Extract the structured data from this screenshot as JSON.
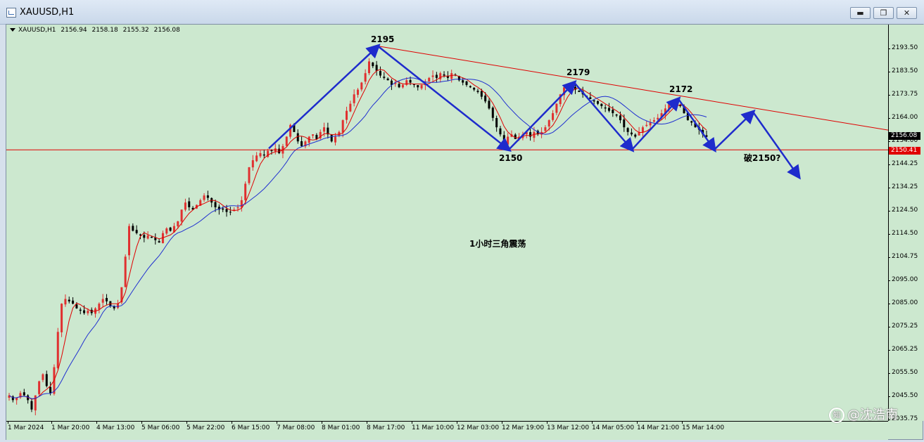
{
  "window": {
    "title": "XAUUSD,H1",
    "buttons": [
      "minimize",
      "restore",
      "close"
    ]
  },
  "header": {
    "symbol": "XAUUSD,H1",
    "open": "2156.94",
    "high": "2158.18",
    "low": "2155.32",
    "close": "2156.08"
  },
  "price_axis": {
    "ticks": [
      "2193.50",
      "2183.50",
      "2173.75",
      "2164.00",
      "2154.00",
      "2144.25",
      "2134.25",
      "2124.50",
      "2114.50",
      "2104.75",
      "2095.00",
      "2085.00",
      "2075.25",
      "2065.25",
      "2055.50",
      "2045.50",
      "2035.75"
    ],
    "current_price": "2156.08",
    "line_price": "2150.41",
    "current_color": "#000000",
    "line_color": "#e00000"
  },
  "time_axis": {
    "ticks": [
      "1 Mar 2024",
      "1 Mar 20:00",
      "4 Mar 13:00",
      "5 Mar 06:00",
      "5 Mar 22:00",
      "6 Mar 15:00",
      "7 Mar 08:00",
      "8 Mar 01:00",
      "8 Mar 17:00",
      "11 Mar 10:00",
      "12 Mar 03:00",
      "12 Mar 19:00",
      "13 Mar 12:00",
      "14 Mar 05:00",
      "14 Mar 21:00",
      "15 Mar 14:00"
    ]
  },
  "annotations": {
    "peak1": "2195",
    "peak2": "2179",
    "peak3": "2172",
    "low1": "2150",
    "break_label": "破2150?",
    "pattern_label": "1小时三角震荡"
  },
  "watermark": "@沈浩南",
  "colors": {
    "background": "#cce8cf",
    "bull_candle": "#e03030",
    "bear_candle": "#000000",
    "ma_fast": "#e00000",
    "ma_slow": "#2030d0",
    "arrow": "#1e2bcc",
    "trendline": "#e00000"
  },
  "chart_data": {
    "type": "candlestick",
    "symbol": "XAUUSD",
    "timeframe": "H1",
    "ylim": [
      2035.75,
      2198
    ],
    "support_level": 2150.41,
    "descending_trendline": [
      [
        2195,
        "8 Mar 17:00"
      ],
      [
        2172,
        "15 Mar 05:00"
      ]
    ],
    "swing_points": [
      {
        "label": "2195",
        "value": 2195,
        "type": "high"
      },
      {
        "label": "2150",
        "value": 2150,
        "type": "low"
      },
      {
        "label": "2179",
        "value": 2179,
        "type": "high"
      },
      {
        "label": "2172",
        "value": 2172,
        "type": "high"
      }
    ],
    "closes": [
      2046,
      2044,
      2045,
      2047,
      2046,
      2044,
      2040,
      2046,
      2052,
      2055,
      2050,
      2047,
      2058,
      2073,
      2085,
      2087,
      2086,
      2085,
      2083,
      2082,
      2081,
      2082,
      2081,
      2083,
      2085,
      2087,
      2086,
      2084,
      2083,
      2085,
      2092,
      2105,
      2118,
      2116,
      2115,
      2114,
      2113,
      2114,
      2113,
      2112,
      2111,
      2115,
      2117,
      2116,
      2118,
      2120,
      2125,
      2128,
      2126,
      2125,
      2127,
      2129,
      2131,
      2130,
      2128,
      2126,
      2125,
      2125,
      2124,
      2124,
      2125,
      2126,
      2129,
      2136,
      2143,
      2146,
      2148,
      2149,
      2148,
      2150,
      2150,
      2151,
      2149,
      2152,
      2156,
      2161,
      2158,
      2154,
      2152,
      2154,
      2156,
      2157,
      2155,
      2158,
      2160,
      2157,
      2154,
      2156,
      2158,
      2163,
      2167,
      2170,
      2174,
      2176,
      2179,
      2183,
      2188,
      2186,
      2184,
      2182,
      2181,
      2180,
      2178,
      2179,
      2177,
      2178,
      2180,
      2179,
      2178,
      2177,
      2178,
      2179,
      2181,
      2182,
      2181,
      2183,
      2182,
      2181,
      2183,
      2182,
      2180,
      2179,
      2178,
      2177,
      2176,
      2175,
      2173,
      2171,
      2168,
      2164,
      2160,
      2157,
      2153,
      2156,
      2157,
      2155,
      2156,
      2157,
      2158,
      2156,
      2158,
      2157,
      2158,
      2160,
      2163,
      2166,
      2170,
      2174,
      2177,
      2178,
      2177,
      2176,
      2175,
      2174,
      2173,
      2172,
      2171,
      2170,
      2169,
      2168,
      2167,
      2166,
      2165,
      2163,
      2160,
      2158,
      2157,
      2156,
      2158,
      2160,
      2161,
      2162,
      2163,
      2164,
      2166,
      2168,
      2170,
      2171,
      2170,
      2169,
      2166,
      2163,
      2162,
      2160,
      2159,
      2157,
      2156
    ]
  }
}
